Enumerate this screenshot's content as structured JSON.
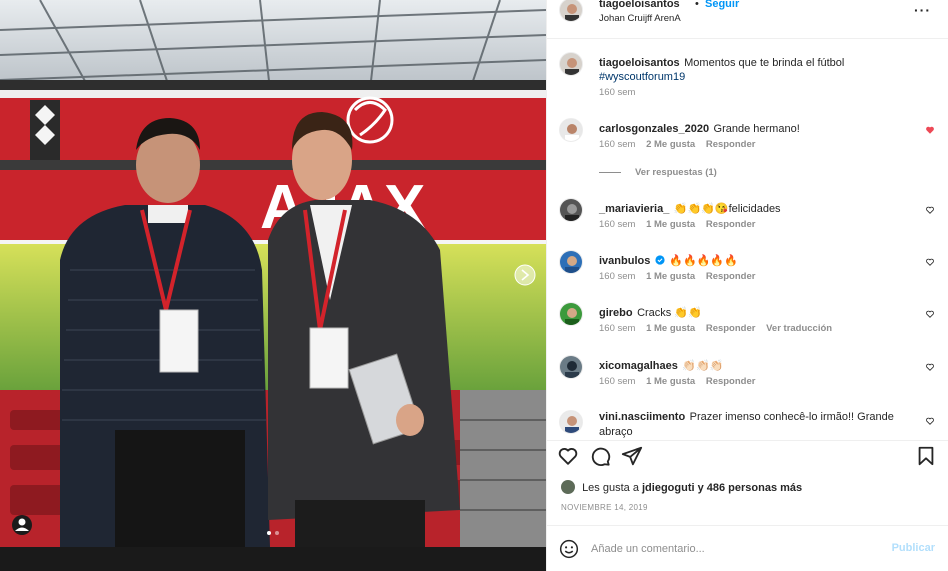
{
  "post": {
    "author": "tiagoeloisantos",
    "follow_label": "Seguir",
    "separator": "•",
    "location": "Johan Cruijff ArenA",
    "more_icon": "more-options-icon",
    "caption_text": "Momentos que te brinda el fútbol",
    "caption_hashtag": "#wyscoutforum19",
    "caption_time": "160 sem"
  },
  "comments": [
    {
      "user": "carlosgonzales_2020",
      "text": "Grande hermano!",
      "time": "160 sem",
      "likes": "2 Me gusta",
      "reply": "Responder",
      "liked": true,
      "view_replies": "Ver respuestas (1)"
    },
    {
      "user": "_mariavieria_",
      "text": "👏👏👏😘felicidades",
      "time": "160 sem",
      "likes": "1 Me gusta",
      "reply": "Responder",
      "liked": false
    },
    {
      "user": "ivanbulos",
      "text": "🔥🔥🔥🔥🔥",
      "time": "160 sem",
      "likes": "1 Me gusta",
      "reply": "Responder",
      "liked": false,
      "verified": true
    },
    {
      "user": "girebo",
      "text": "Cracks 👏👏",
      "time": "160 sem",
      "likes": "1 Me gusta",
      "reply": "Responder",
      "liked": false,
      "translate": "Ver traducción"
    },
    {
      "user": "xicomagalhaes",
      "text": "👏🏻👏🏻👏🏻",
      "time": "160 sem",
      "likes": "1 Me gusta",
      "reply": "Responder",
      "liked": false
    },
    {
      "user": "vini.nasciimento",
      "text": "Prazer imenso conhecê-lo irmão!! Grande abraço",
      "liked": false
    }
  ],
  "likes_summary": {
    "prefix": "Les gusta a ",
    "user": "jdiegoguti",
    "suffix": " y 486 personas más"
  },
  "date": "NOVIEMBRE 14, 2019",
  "add_comment": {
    "placeholder": "Añade un comentario...",
    "publish": "Publicar"
  },
  "colors": {
    "accent": "#0095f6",
    "liked_heart": "#ed4956",
    "muted": "#8e8e8e"
  }
}
